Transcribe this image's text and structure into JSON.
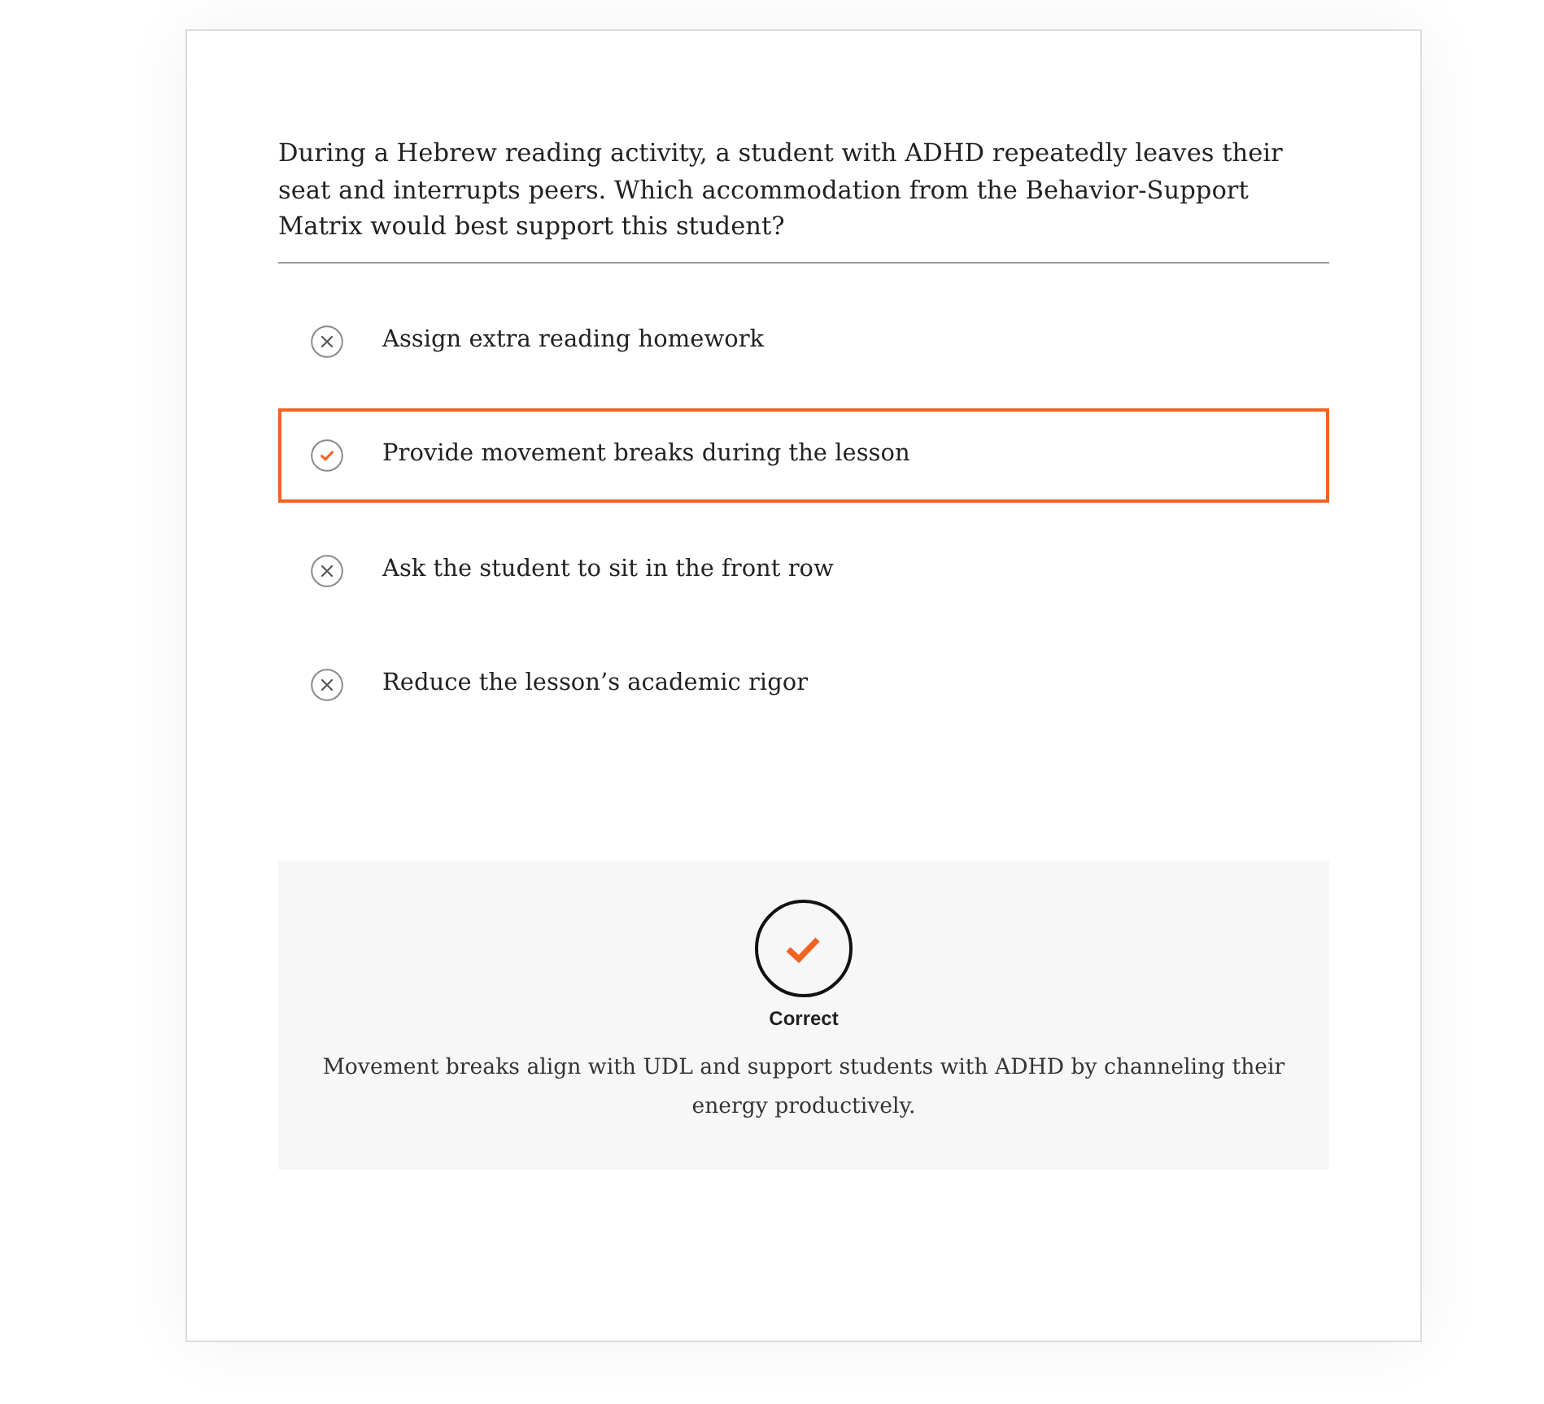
{
  "question": {
    "text": "During a Hebrew reading activity, a student with ADHD repeatedly leaves their seat and interrupts peers. Which accommodation from the Behavior-Support Matrix would best support this student?"
  },
  "options": [
    {
      "label": "Assign extra reading homework",
      "selected": false,
      "correct": false
    },
    {
      "label": "Provide movement breaks during the lesson",
      "selected": true,
      "correct": true
    },
    {
      "label": "Ask the student to sit in the front row",
      "selected": false,
      "correct": false
    },
    {
      "label": "Reduce the lesson’s academic rigor",
      "selected": false,
      "correct": false
    }
  ],
  "feedback": {
    "kind": "correct",
    "status": "Correct",
    "explanation": "Movement breaks align with UDL and support students with ADHD by channeling their energy productively."
  }
}
